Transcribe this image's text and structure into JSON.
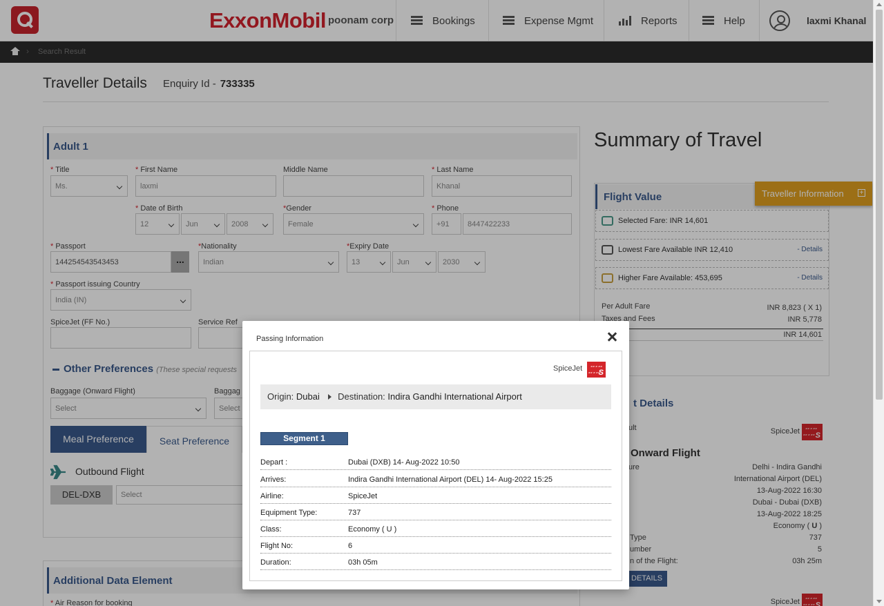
{
  "header": {
    "brand": "ExxonMobil",
    "company": "poonam corp",
    "nav": [
      "Bookings",
      "Expense Mgmt",
      "Reports",
      "Help"
    ],
    "user": "laxmi Khanal"
  },
  "breadcrumb": {
    "current": "Search Result"
  },
  "page": {
    "title": "Traveller Details",
    "enquiry_label": "Enquiry Id -",
    "enquiry_id": "733335"
  },
  "traveller_form": {
    "section_title": "Adult 1",
    "labels": {
      "title": "Title",
      "first_name": "First Name",
      "middle_name": "Middle Name",
      "last_name": "Last Name",
      "dob": "Date of Birth",
      "gender": "Gender",
      "phone": "Phone",
      "passport": "Passport",
      "nationality": "Nationality",
      "expiry": "Expiry Date",
      "passport_country": "Passport issuing Country",
      "ff_no": "SpiceJet (FF No.)",
      "service_ref": "Service Ref"
    },
    "values": {
      "title": "Ms.",
      "first_name": "laxmi",
      "middle_name": "",
      "last_name": "Khanal",
      "dob_day": "12",
      "dob_month": "Jun",
      "dob_year": "2008",
      "gender": "Female",
      "phone_code": "+91",
      "phone": "8447422233",
      "passport": "144254543543453",
      "nationality": "Indian",
      "expiry_day": "13",
      "expiry_month": "Jun",
      "expiry_year": "2030",
      "passport_country": "India (IN)"
    },
    "ellipsis": "...",
    "other_pref_title": "Other Preferences",
    "other_pref_note": "(These special requests",
    "baggage_onward": "Baggage (Onward Flight)",
    "baggage_return": "Baggag",
    "select": "Select",
    "tabs": [
      "Meal Preference",
      "Seat Preference"
    ],
    "outbound": "Outbound Flight",
    "route_chip": "DEL-DXB"
  },
  "additional": {
    "title": "Additional Data Element",
    "air_reason": "Air Reason for booking"
  },
  "summary": {
    "title": "Summary of Travel",
    "flight_value": "Flight Value",
    "selected_fare": "Selected Fare: INR 14,601",
    "lowest_fare": "Lowest Fare Available INR 12,410",
    "higher_fare": "Higher Fare Available: 453,695",
    "details_link": "- Details",
    "per_adult_label": "Per Adult Fare",
    "per_adult_value": "INR 8,823 ( X 1)",
    "taxes_label": "Taxes and Fees",
    "taxes_value": "INR 5,778",
    "total_value": "INR 14,601",
    "traveller_info": "Traveller Information",
    "flight_details_title": "t Details",
    "adult_label": "ult",
    "airline": "SpiceJet",
    "onward_title": "Onward Flight",
    "depart_label": "ure",
    "depart_lines": [
      "Delhi - Indira Gandhi",
      "International Airport (DEL)",
      "13-Aug-2022 16:30",
      "Dubai - Dubai (DXB)",
      "13-Aug-2022 18:25"
    ],
    "class_value": "Economy ( ",
    "class_code": "U",
    "class_end": " )",
    "equip_label": "Type",
    "equip_value": "737",
    "flightno_label": "umber",
    "flightno_value": "5",
    "duration_label": "n of the Flight:",
    "duration_value": "03h 25m",
    "details_btn": "DETAILS",
    "airline2": "SpiceJet"
  },
  "modal": {
    "title": "Passing Information",
    "airline": "SpiceJet",
    "origin_label": "Origin:",
    "origin": "Dubai",
    "destination_label": "Destination:",
    "destination": "Indira Gandhi International Airport",
    "segment": "Segment 1",
    "rows": [
      {
        "k": "Depart :",
        "v": "Dubai (DXB) 14- Aug-2022 10:50"
      },
      {
        "k": "Arrives:",
        "v": "Indira Gandhi International Airport (DEL) 14- Aug-2022 15:25"
      },
      {
        "k": "Airline:",
        "v": "SpiceJet"
      },
      {
        "k": "Equipment Type:",
        "v": "737"
      },
      {
        "k": "Class:",
        "v": "Economy ( U )"
      },
      {
        "k": "Flight No:",
        "v": "6"
      },
      {
        "k": "Duration:",
        "v": "03h 05m"
      }
    ]
  },
  "colors": {
    "accent": "#3a5a8c",
    "brand_red": "#d2222d",
    "traveller_tab": "#e0a020"
  }
}
